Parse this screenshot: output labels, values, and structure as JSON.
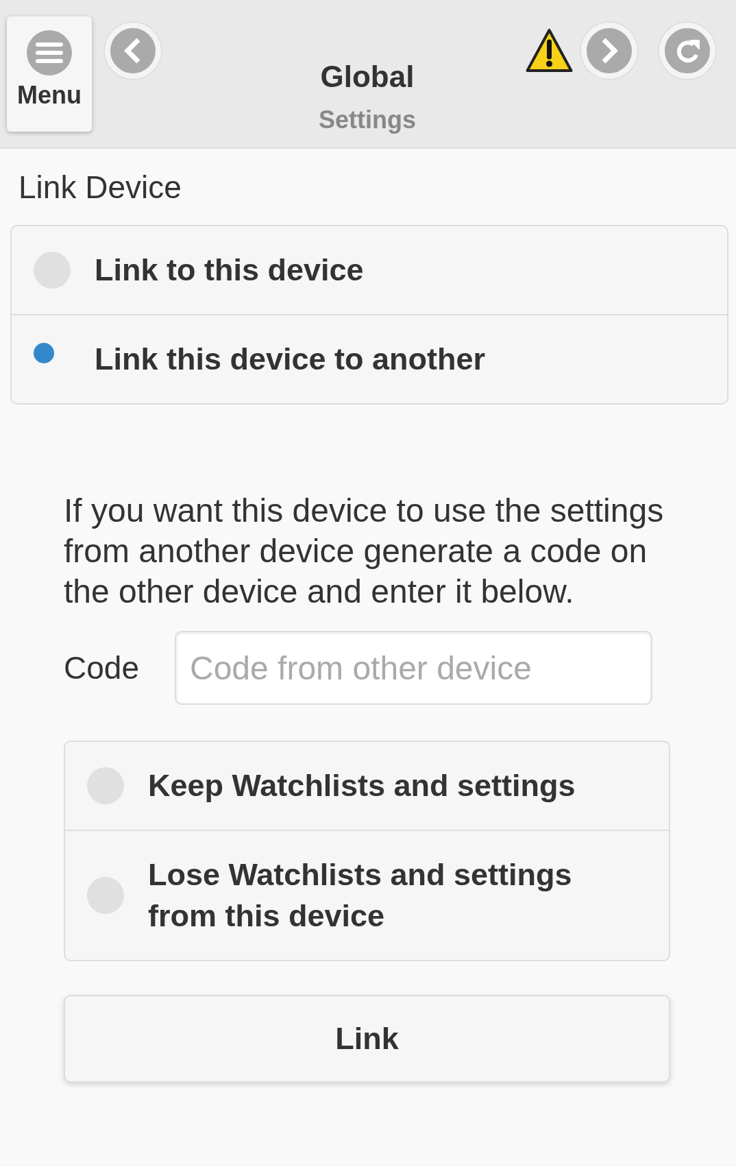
{
  "header": {
    "menu_button": {
      "label": "Menu"
    },
    "title": "Global",
    "subtitle": "Settings"
  },
  "section_title": "Link Device",
  "link_mode": {
    "options": [
      {
        "label": "Link to this device",
        "selected": false
      },
      {
        "label": "Link this device to another",
        "selected": true
      }
    ]
  },
  "instructions": "If you want this device to use the settings from another device generate a code on the other device and enter it below.",
  "code_field": {
    "label": "Code",
    "placeholder": "Code from other device"
  },
  "keep_settings": {
    "options": [
      {
        "label": "Keep Watchlists and settings",
        "selected": false
      },
      {
        "label": "Lose Watchlists and settings from this device",
        "selected": false
      }
    ]
  },
  "link_button": {
    "label": "Link"
  }
}
